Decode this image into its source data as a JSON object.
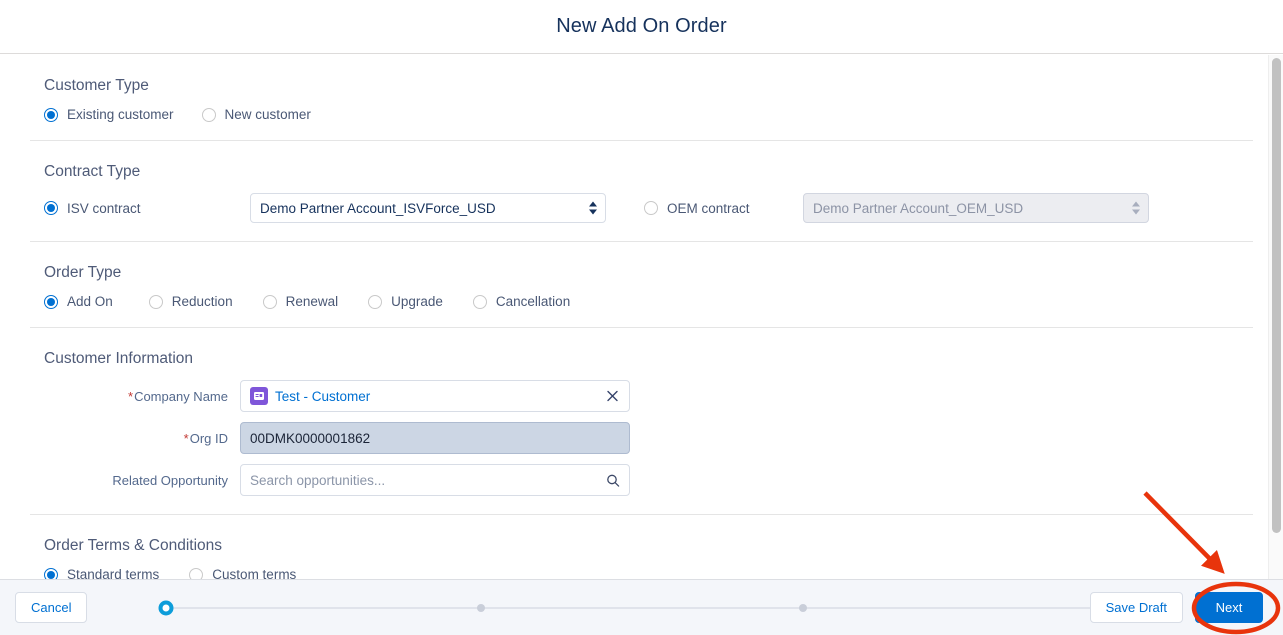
{
  "header": {
    "title": "New Add On Order"
  },
  "sections": {
    "customer_type": {
      "title": "Customer Type",
      "options": [
        {
          "label": "Existing customer",
          "selected": true
        },
        {
          "label": "New customer",
          "selected": false
        }
      ]
    },
    "contract_type": {
      "title": "Contract Type",
      "isv": {
        "label": "ISV contract",
        "selected": true,
        "value": "Demo Partner Account_ISVForce_USD"
      },
      "oem": {
        "label": "OEM contract",
        "selected": false,
        "value": "Demo Partner Account_OEM_USD",
        "disabled": true
      }
    },
    "order_type": {
      "title": "Order Type",
      "options": [
        {
          "label": "Add On",
          "selected": true
        },
        {
          "label": "Reduction",
          "selected": false
        },
        {
          "label": "Renewal",
          "selected": false
        },
        {
          "label": "Upgrade",
          "selected": false
        },
        {
          "label": "Cancellation",
          "selected": false
        }
      ]
    },
    "customer_information": {
      "title": "Customer Information",
      "fields": {
        "company_name": {
          "label": "Company Name",
          "required": true,
          "value": "Test - Customer",
          "icon": "account-icon",
          "clear_icon": "close-icon"
        },
        "org_id": {
          "label": "Org ID",
          "required": true,
          "value": "00DMK0000001862"
        },
        "related_opportunity": {
          "label": "Related Opportunity",
          "required": false,
          "value": "",
          "placeholder": "Search opportunities...",
          "search_icon": "search-icon"
        }
      }
    },
    "order_terms": {
      "title": "Order Terms & Conditions",
      "options": [
        {
          "label": "Standard terms",
          "selected": true
        },
        {
          "label": "Custom terms",
          "selected": false
        }
      ]
    }
  },
  "footer": {
    "cancel_label": "Cancel",
    "save_draft_label": "Save Draft",
    "next_label": "Next",
    "progress": {
      "total_steps": 4,
      "current_step": 1
    }
  },
  "annotation": {
    "arrow_color": "#e8340c",
    "highlight_target": "next-button"
  },
  "colors": {
    "brand_blue": "#0070d2",
    "title_navy": "#16325c",
    "label_slate": "#54698d",
    "required_red": "#c23934",
    "annotation_red": "#e8340c"
  }
}
